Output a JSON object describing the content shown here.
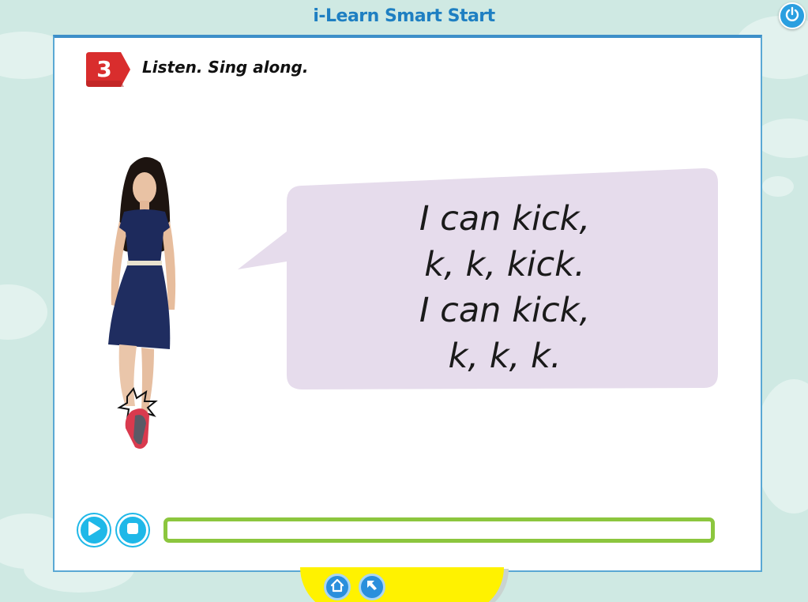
{
  "app": {
    "title": "i-Learn Smart Start"
  },
  "activity": {
    "number": "3",
    "instruction": "Listen. Sing along."
  },
  "song": {
    "lines": [
      "I can kick,",
      "k, k, kick.",
      "I can kick,",
      "k, k, k."
    ]
  },
  "player": {
    "progress": 0
  },
  "icons": {
    "power": "power-icon",
    "play": "play-icon",
    "stop": "stop-icon",
    "home": "home-icon",
    "back": "back-arrow-icon"
  },
  "colors": {
    "accent_blue": "#1e7fc2",
    "button_cyan": "#1fb8e8",
    "progress_green": "#8cc63e",
    "bubble": "#e6dcec",
    "badge_red": "#d92d2d",
    "nav_yellow": "#fff200"
  }
}
